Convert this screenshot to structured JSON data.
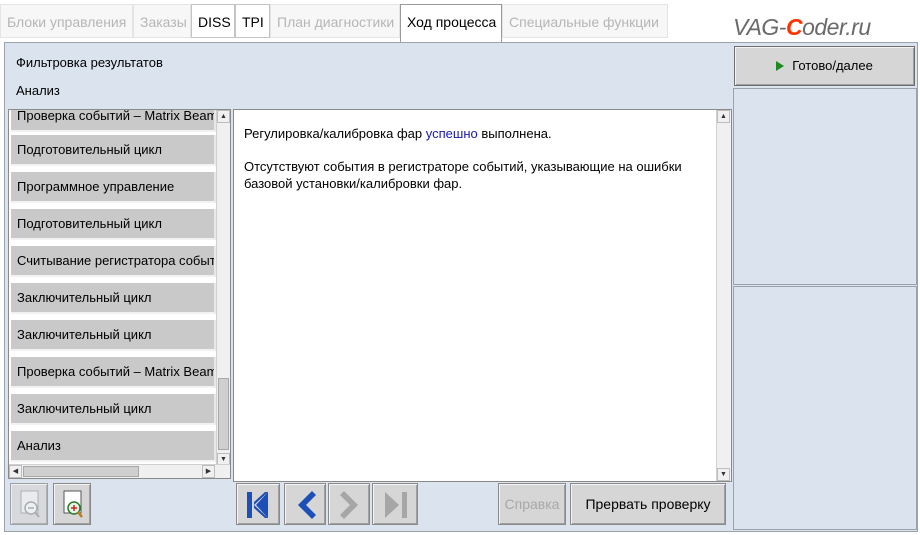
{
  "tabs": [
    {
      "label": "Блоки управления",
      "state": "disabled"
    },
    {
      "label": "Заказы",
      "state": "disabled"
    },
    {
      "label": "DISS",
      "state": "enabled"
    },
    {
      "label": "TPI",
      "state": "enabled"
    },
    {
      "label": "План диагностики",
      "state": "disabled"
    },
    {
      "label": "Ход процесса",
      "state": "active"
    },
    {
      "label": "Специальные функции",
      "state": "disabled"
    }
  ],
  "watermark": {
    "part1": "VAG-",
    "part2": "C",
    "part3": "oder.ru"
  },
  "header": {
    "line1": "Фильтровка результатов",
    "line2": "Анализ"
  },
  "steps": [
    "Проверка событий – Matrix Beam",
    "Подготовительный цикл",
    "Программное управление",
    "Подготовительный цикл",
    "Считывание регистратора событий",
    "Заключительный цикл",
    "Заключительный цикл",
    "Проверка событий – Matrix Beam",
    "Заключительный цикл",
    "Анализ"
  ],
  "result": {
    "line1_before": "Регулировка/калибровка фар ",
    "line1_highlight": "успешно",
    "line1_after": " выполнена.",
    "line2": "Отсутствуют события в регистраторе событий, указывающие на ошибки базовой установки/калибровки фар."
  },
  "buttons": {
    "done": "Готово/далее",
    "help": "Справка",
    "abort": "Прервать проверку"
  },
  "icons": {
    "first": "first-icon",
    "prev": "prev-icon",
    "next": "next-icon",
    "last": "last-icon",
    "zoom_out": "zoom-out-icon",
    "zoom_in": "zoom-in-icon"
  },
  "colors": {
    "accent": "#1a1aa8",
    "panel": "#dbe4ee",
    "nav_blue": "#1d4fb8",
    "done_arrow": "#1f8a1f"
  }
}
